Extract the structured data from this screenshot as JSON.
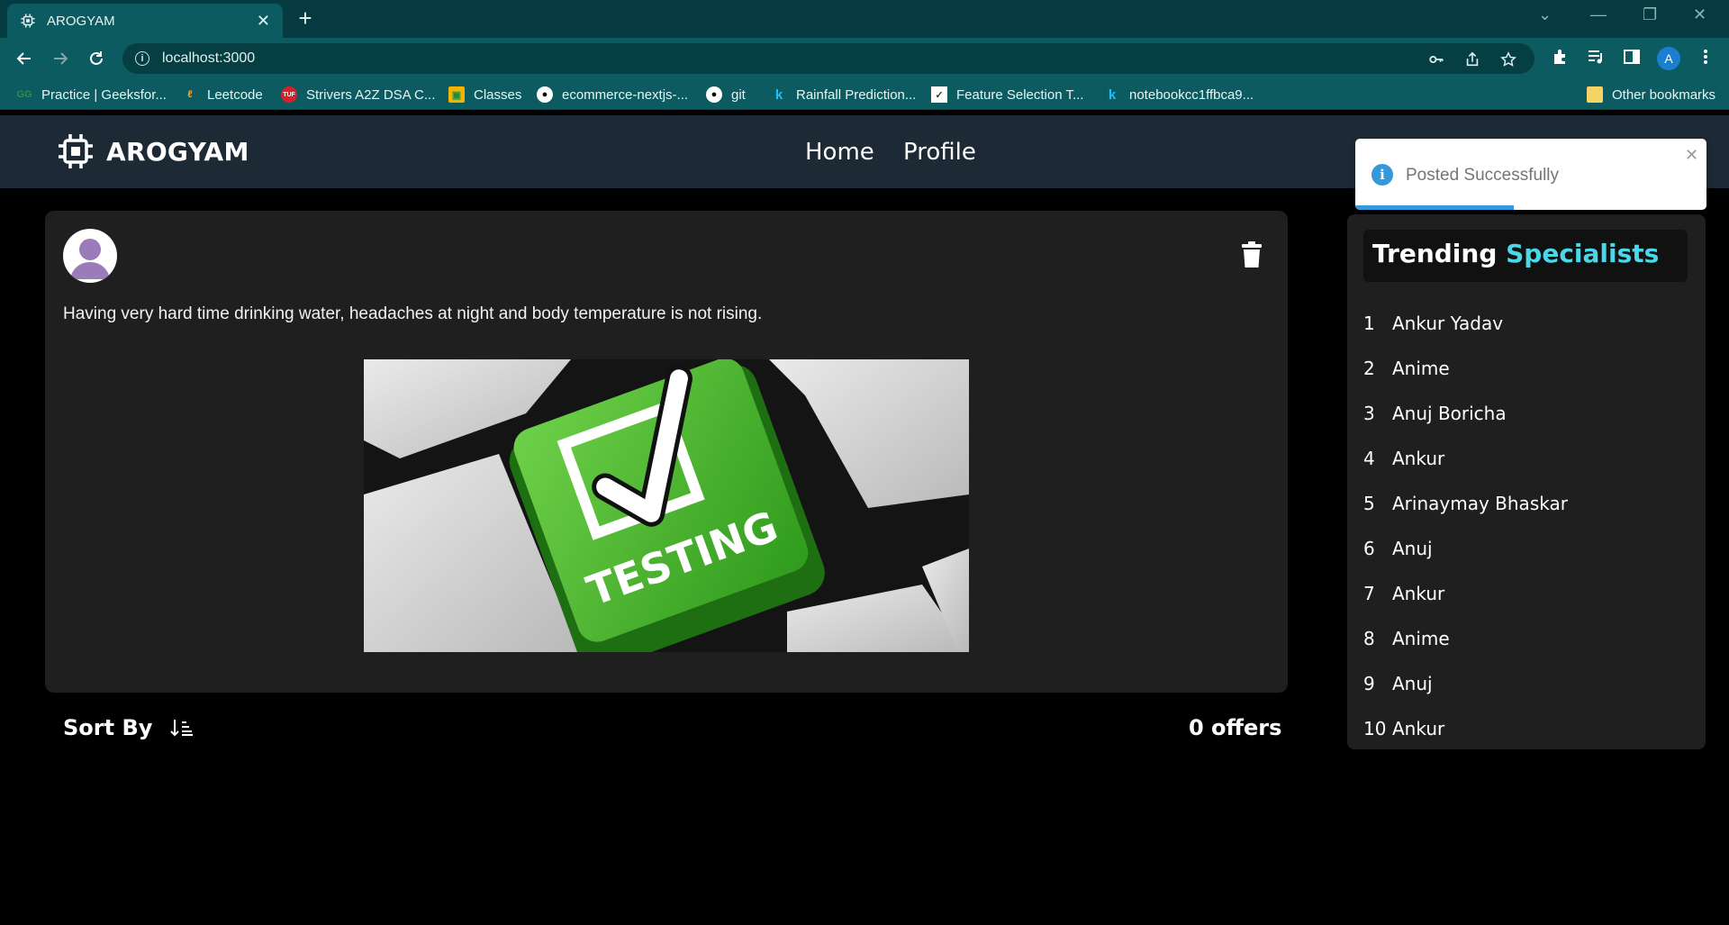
{
  "browser": {
    "tab_title": "AROGYAM",
    "url": "localhost:3000",
    "avatar_letter": "A",
    "bookmarks": [
      "Practice | Geeksfor...",
      "Leetcode",
      "Strivers A2Z DSA C...",
      "Classes",
      "ecommerce-nextjs-...",
      "git",
      "Rainfall Prediction...",
      "Feature Selection T...",
      "notebookcc1ffbca9..."
    ],
    "other_bookmarks": "Other bookmarks"
  },
  "app": {
    "brand": "AROGYAM",
    "nav": {
      "home": "Home",
      "profile": "Profile"
    }
  },
  "post": {
    "text": "Having very hard time drinking water, headaches at night and body temperature is not rising.",
    "image_caption": "TESTING"
  },
  "feed": {
    "sort_label": "Sort By",
    "offers_label": "0 offers"
  },
  "trending": {
    "title_part1": "Trending",
    "title_part2": "Specialists",
    "items": [
      {
        "rank": "1",
        "name": "Ankur Yadav"
      },
      {
        "rank": "2",
        "name": "Anime"
      },
      {
        "rank": "3",
        "name": "Anuj Boricha"
      },
      {
        "rank": "4",
        "name": "Ankur"
      },
      {
        "rank": "5",
        "name": "Arinaymay Bhaskar"
      },
      {
        "rank": "6",
        "name": "Anuj"
      },
      {
        "rank": "7",
        "name": "Ankur"
      },
      {
        "rank": "8",
        "name": "Anime"
      },
      {
        "rank": "9",
        "name": "Anuj"
      },
      {
        "rank": "10",
        "name": "Ankur"
      }
    ]
  },
  "toast": {
    "message": "Posted Successfully",
    "progress": 0.45
  },
  "colors": {
    "accent": "#4ad7e7",
    "header_bg": "#1d2a36",
    "card_bg": "#1f1f1f",
    "toast_info": "#3498db",
    "browser_frame": "#0b5b60"
  }
}
